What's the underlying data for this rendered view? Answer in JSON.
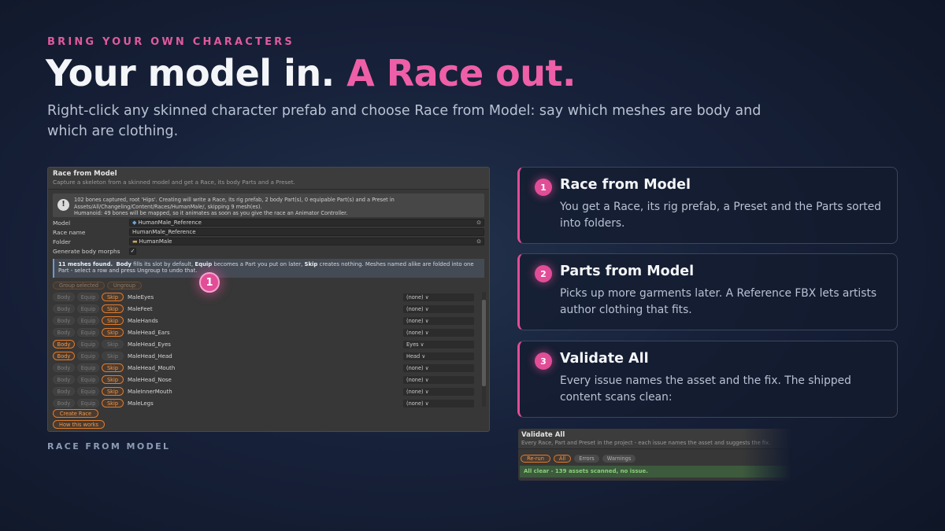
{
  "hero": {
    "eyebrow": "BRING YOUR OWN CHARACTERS",
    "headline_lead": "Your model in.",
    "headline_accent": "A Race out.",
    "subtitle": "Right-click any skinned character prefab and choose Race from Model: say which meshes are body and which are clothing."
  },
  "race_window": {
    "title": "Race from Model",
    "description": "Capture a skeleton from a skinned model and get a Race, its body Parts and a Preset.",
    "info_icon": "exclamation-icon",
    "info_lines": [
      "102 bones captured, root 'Hips'. Creating will write a Race, its rig prefab, 2 body Part(s), 0 equipable Part(s) and a Preset in",
      "Assets/All/Changeling/Content/Races/HumanMale/, skipping 9 mesh(es).",
      "Humanoid: 49 bones will be mapped, so it animates as soon as you give the race an Animator Controller."
    ],
    "fields": {
      "model_label": "Model",
      "model_value": "HumanMale_Reference",
      "race_name_label": "Race name",
      "race_name_value": "HumanMale_Reference",
      "folder_label": "Folder",
      "folder_value": "HumanMale",
      "generate_morphs_label": "Generate body morphs",
      "generate_morphs_check": "✓"
    },
    "note": {
      "count": "11 meshes found.",
      "body_word": "Body",
      "t1": " fills its slot by default, ",
      "equip_word": "Equip",
      "t2": " becomes a Part you put on later, ",
      "skip_word": "Skip",
      "t3": " creates nothing. Meshes named alike are folded into one Part - select a row and press Ungroup to undo that."
    },
    "group_selected": "Group selected",
    "ungroup": "Ungroup",
    "btn_body": "Body",
    "btn_equip": "Equip",
    "btn_skip": "Skip",
    "meshes": [
      {
        "name": "MaleEyes",
        "choice": "skip",
        "slot": "(none) ∨"
      },
      {
        "name": "MaleFeet",
        "choice": "skip",
        "slot": "(none) ∨"
      },
      {
        "name": "MaleHands",
        "choice": "skip",
        "slot": "(none) ∨"
      },
      {
        "name": "MaleHead_Ears",
        "choice": "skip",
        "slot": "(none) ∨"
      },
      {
        "name": "MaleHead_Eyes",
        "choice": "body",
        "slot": "Eyes ∨"
      },
      {
        "name": "MaleHead_Head",
        "choice": "body",
        "slot": "Head ∨"
      },
      {
        "name": "MaleHead_Mouth",
        "choice": "skip",
        "slot": "(none) ∨"
      },
      {
        "name": "MaleHead_Nose",
        "choice": "skip",
        "slot": "(none) ∨"
      },
      {
        "name": "MaleInnerMouth",
        "choice": "skip",
        "slot": "(none) ∨"
      },
      {
        "name": "MaleLegs",
        "choice": "skip",
        "slot": "(none) ∨"
      }
    ],
    "create_race": "Create Race",
    "how_this_works": "How this works",
    "marker": "1"
  },
  "caption": "RACE FROM MODEL",
  "steps": [
    {
      "num": "1",
      "title": "Race from Model",
      "body": "You get a Race, its rig prefab, a Preset and the Parts sorted into folders."
    },
    {
      "num": "2",
      "title": "Parts from Model",
      "body": "Picks up more garments later. A Reference FBX lets artists author clothing that fits."
    },
    {
      "num": "3",
      "title": "Validate All",
      "body": "Every issue names the asset and the fix. The shipped content scans clean:"
    }
  ],
  "validate_window": {
    "title": "Validate All",
    "description": "Every Race, Part and Preset in the project - each issue names the asset and suggests the fix.",
    "rerun": "Re-run",
    "all": "All",
    "errors": "Errors",
    "warnings": "Warnings",
    "status": "All clear - 139 assets scanned, no issue."
  },
  "colors": {
    "accent_pink": "#e24d97",
    "unity_orange": "#e07b2c",
    "status_green": "#88d07a"
  }
}
